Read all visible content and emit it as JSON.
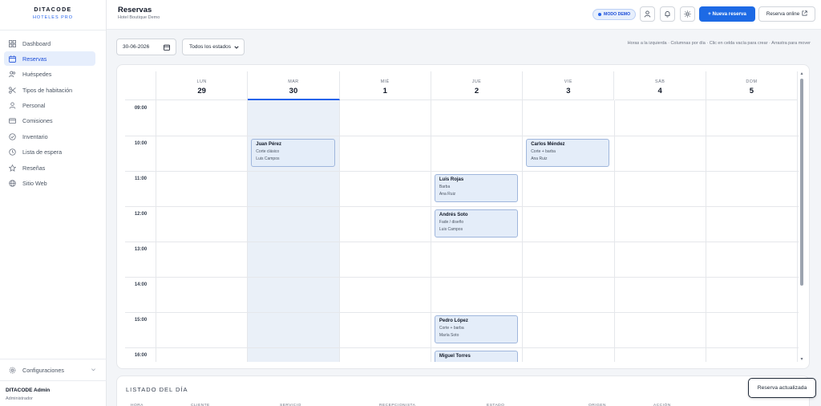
{
  "brand": {
    "name": "DITACODE",
    "sub": "HOTELES PRO"
  },
  "sidebar": {
    "items": [
      {
        "label": "Dashboard",
        "icon": "grid-icon"
      },
      {
        "label": "Reservas",
        "icon": "calendar-icon",
        "active": true
      },
      {
        "label": "Huéspedes",
        "icon": "users-icon"
      },
      {
        "label": "Tipos de habitación",
        "icon": "scissors-icon"
      },
      {
        "label": "Personal",
        "icon": "user-icon"
      },
      {
        "label": "Comisiones",
        "icon": "wallet-icon"
      },
      {
        "label": "Inventario",
        "icon": "box-icon"
      },
      {
        "label": "Lista de espera",
        "icon": "clock-icon"
      },
      {
        "label": "Reseñas",
        "icon": "star-icon"
      },
      {
        "label": "Sitio Web",
        "icon": "globe-icon"
      }
    ],
    "config_label": "Configuraciones",
    "user_name": "DITACODE Admin",
    "user_role": "Administrador"
  },
  "header": {
    "title": "Reservas",
    "subtitle": "Hotel Boutique Demo",
    "demo_badge": "MODO DEMO",
    "new_button": "+  Nueva reserva",
    "online_button": "Reserva online"
  },
  "toolbar": {
    "date_value": "30-06-2026",
    "status_value": "Todos los estados",
    "hint": "Horas a la izquierda · Columnas por día · Clic en celda vacía para crear · Arrastra para mover"
  },
  "calendar": {
    "days": [
      {
        "name": "LUN",
        "num": "29"
      },
      {
        "name": "MAR",
        "num": "30",
        "today": true
      },
      {
        "name": "MIÉ",
        "num": "1"
      },
      {
        "name": "JUE",
        "num": "2"
      },
      {
        "name": "VIE",
        "num": "3"
      },
      {
        "name": "SÁB",
        "num": "4"
      },
      {
        "name": "DOM",
        "num": "5"
      }
    ],
    "hours": [
      "09:00",
      "10:00",
      "11:00",
      "12:00",
      "13:00",
      "14:00",
      "15:00",
      "16:00"
    ],
    "bookings": [
      {
        "client": "Juan Pérez",
        "service": "Corte clásico",
        "staff": "Luis Campos",
        "day": 1,
        "hour": 1
      },
      {
        "client": "Carlos Méndez",
        "service": "Corte + barba",
        "staff": "Ana Ruiz",
        "day": 4,
        "hour": 1
      },
      {
        "client": "Luis Rojas",
        "service": "Barba",
        "staff": "Ana Ruiz",
        "day": 3,
        "hour": 2
      },
      {
        "client": "Andrés Soto",
        "service": "Fade / diseño",
        "staff": "Luis Campos",
        "day": 3,
        "hour": 3
      },
      {
        "client": "Pedro López",
        "service": "Corte + barba",
        "staff": "María Soto",
        "day": 3,
        "hour": 6
      },
      {
        "client": "Miguel Torres",
        "service": "",
        "staff": "",
        "day": 3,
        "hour": 7
      }
    ]
  },
  "day_list": {
    "title": "LISTADO DEL DÍA",
    "columns": [
      "HORA",
      "CLIENTE",
      "SERVICIO",
      "RECEPCIONISTA",
      "ESTADO",
      "ORIGEN",
      "ACCIÓN"
    ]
  },
  "toast": "Reserva actualizada",
  "colors": {
    "accent": "#1d6ae5",
    "today_bg": "#eaf0f8",
    "booking_bg": "#e4edf9"
  }
}
